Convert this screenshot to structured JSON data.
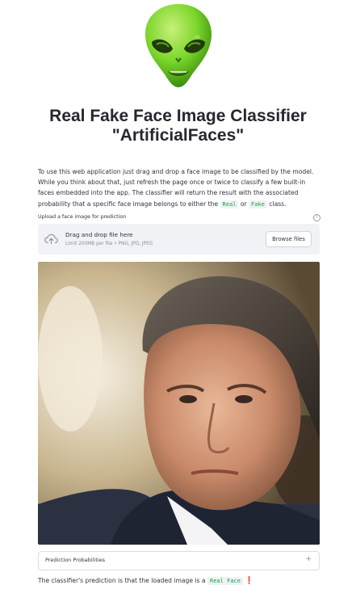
{
  "header": {
    "title_line1": "Real Fake Face Image Classifier",
    "title_line2": "\"ArtificialFaces\""
  },
  "intro": {
    "text_before": "To use this web application just drag and drop a face image to be classified by the model. While you think about that, just refresh the page once or twice to classify a few built-in faces embedded into the app. The classifier will return the result with the associated probability that a specific face image belongs to either the ",
    "real_code": "Real",
    "or_text": " or ",
    "fake_code": "Fake",
    "text_after": " class."
  },
  "uploader": {
    "label": "Upload a face image for prediction",
    "help_icon": "?",
    "drop_title": "Drag and drop file here",
    "drop_subtitle": "Limit 200MB per file • PNG, JPG, JPEG",
    "browse_label": "Browse files",
    "icon": "cloud-upload-icon"
  },
  "expander": {
    "label": "Prediction Probabilities",
    "toggle": "+"
  },
  "prediction": {
    "text_before": "The classifier's prediction is that the loaded image is a ",
    "label": "Real Face",
    "exclamation": "❗"
  },
  "colors": {
    "code_green": "#09ab3b",
    "dropzone_bg": "#f0f2f6",
    "alien_green": "#7bd62b"
  }
}
